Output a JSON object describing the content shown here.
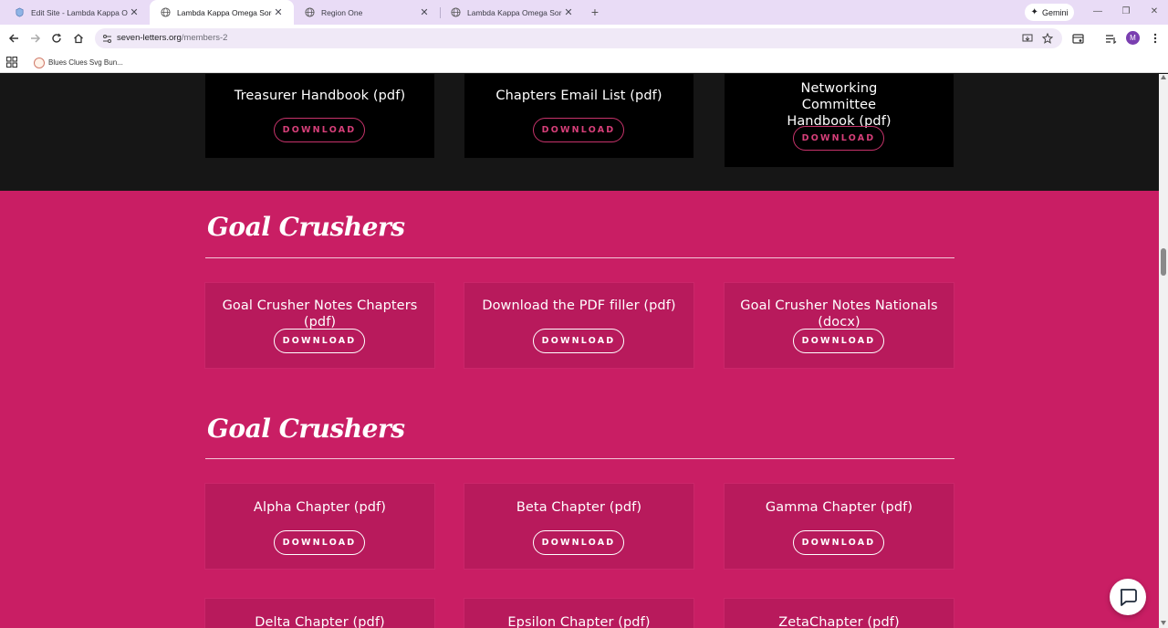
{
  "browser": {
    "tabs": [
      {
        "title": "Edit Site - Lambda Kappa Omega",
        "active": false,
        "icon": "site-icon"
      },
      {
        "title": "Lambda Kappa Omega Sorority",
        "active": true,
        "icon": "globe-icon"
      },
      {
        "title": "Region One",
        "active": false,
        "icon": "globe-icon"
      },
      {
        "title": "Lambda Kappa Omega Sorority",
        "active": false,
        "icon": "globe-icon"
      }
    ],
    "new_tab_symbol": "+",
    "gemini_label": "Gemini",
    "url_host": "seven-letters.org",
    "url_path": "/members-2",
    "avatar_initial": "M",
    "bookmarks": [
      {
        "label": "Blues Clues Svg Bun..."
      }
    ]
  },
  "page": {
    "colors": {
      "dark_bg": "#161616",
      "pink_bg": "#c91e64",
      "pink_card": "#b81a5c",
      "accent": "#d63f79"
    },
    "top_cards": [
      {
        "title": "Treasurer Handbook (pdf)",
        "button": "DOWNLOAD"
      },
      {
        "title": "Chapters Email List (pdf)",
        "button": "DOWNLOAD"
      },
      {
        "title": "Networking Committee Handbook (pdf)",
        "button": "DOWNLOAD"
      }
    ],
    "sections": [
      {
        "heading": "Goal Crushers",
        "cards": [
          {
            "title": "Goal Crusher Notes Chapters (pdf)",
            "button": "DOWNLOAD"
          },
          {
            "title": "Download the PDF filler (pdf)",
            "button": "DOWNLOAD"
          },
          {
            "title": "Goal Crusher Notes Nationals (docx)",
            "button": "DOWNLOAD"
          }
        ]
      },
      {
        "heading": "Goal Crushers",
        "cards": [
          {
            "title": "Alpha Chapter (pdf)",
            "button": "DOWNLOAD"
          },
          {
            "title": "Beta Chapter (pdf)",
            "button": "DOWNLOAD"
          },
          {
            "title": "Gamma Chapter (pdf)",
            "button": "DOWNLOAD"
          }
        ]
      }
    ],
    "bottom_cards": [
      {
        "title": "Delta Chapter (pdf)"
      },
      {
        "title": "Epsilon Chapter (pdf)"
      },
      {
        "title": "ZetaChapter (pdf)"
      }
    ]
  }
}
